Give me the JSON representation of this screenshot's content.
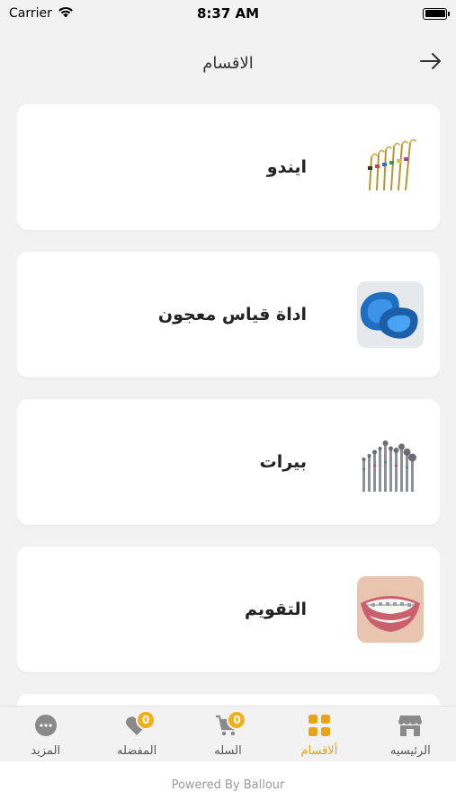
{
  "status_bar": {
    "carrier": "Carrier",
    "time": "8:37 AM"
  },
  "header": {
    "title": "الاقسام",
    "back_icon": "arrow-right-icon"
  },
  "categories": [
    {
      "label": "ايندو",
      "image": "endo-files-icon"
    },
    {
      "label": "اداة قياس معجون",
      "image": "impression-tray-icon"
    },
    {
      "label": "بيرات",
      "image": "dental-burs-icon"
    },
    {
      "label": "التقويم",
      "image": "braces-smile-icon"
    }
  ],
  "tabbar": {
    "items": [
      {
        "label": "الرئيسيه",
        "icon": "store-icon",
        "active": false
      },
      {
        "label": "ألاقسام",
        "icon": "grid-icon",
        "active": true
      },
      {
        "label": "السله",
        "icon": "cart-icon",
        "badge": "0",
        "active": false
      },
      {
        "label": "المفضله",
        "icon": "heart-icon",
        "badge": "0",
        "active": false
      },
      {
        "label": "المزيد",
        "icon": "more-icon",
        "active": false
      }
    ],
    "active_color": "#e8a317",
    "badge_color": "#f1b01a"
  },
  "footer": {
    "text": "Powered By Ballour"
  }
}
